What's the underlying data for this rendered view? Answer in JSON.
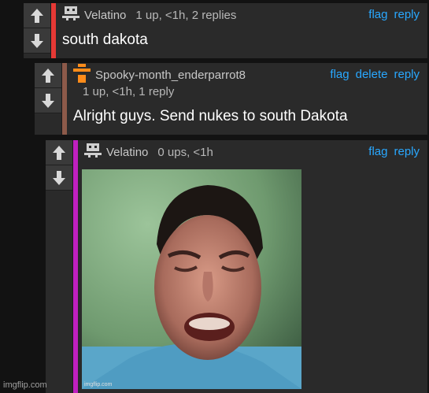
{
  "comments": [
    {
      "username": "Velatino",
      "meta": "1 up, <1h, 2 replies",
      "actions": [
        "flag",
        "reply"
      ],
      "text": "south dakota",
      "bar_color": "#e53935",
      "avatar_color": "#cfcfcf"
    },
    {
      "username": "Spooky-month_enderparrot8",
      "meta": "1 up, <1h, 1 reply",
      "actions": [
        "flag",
        "delete",
        "reply"
      ],
      "text": "Alright guys. Send nukes to south Dakota",
      "bar_color": "#8d5a4a",
      "avatar_color": "#ff8c1a"
    },
    {
      "username": "Velatino",
      "meta": "0 ups, <1h",
      "actions": [
        "flag",
        "reply"
      ],
      "image_alt": "crying boy reaction meme",
      "image_watermark": "imgflip.com",
      "bar_color": "#c020c0",
      "avatar_color": "#cfcfcf"
    }
  ],
  "watermark": "imgflip.com",
  "colors": {
    "link": "#29a8ff",
    "panel": "#2a2a2a",
    "background": "#121212"
  },
  "icons": [
    "upvote-arrow-icon",
    "downvote-arrow-icon",
    "skull-avatar-icon",
    "hat-avatar-icon"
  ]
}
